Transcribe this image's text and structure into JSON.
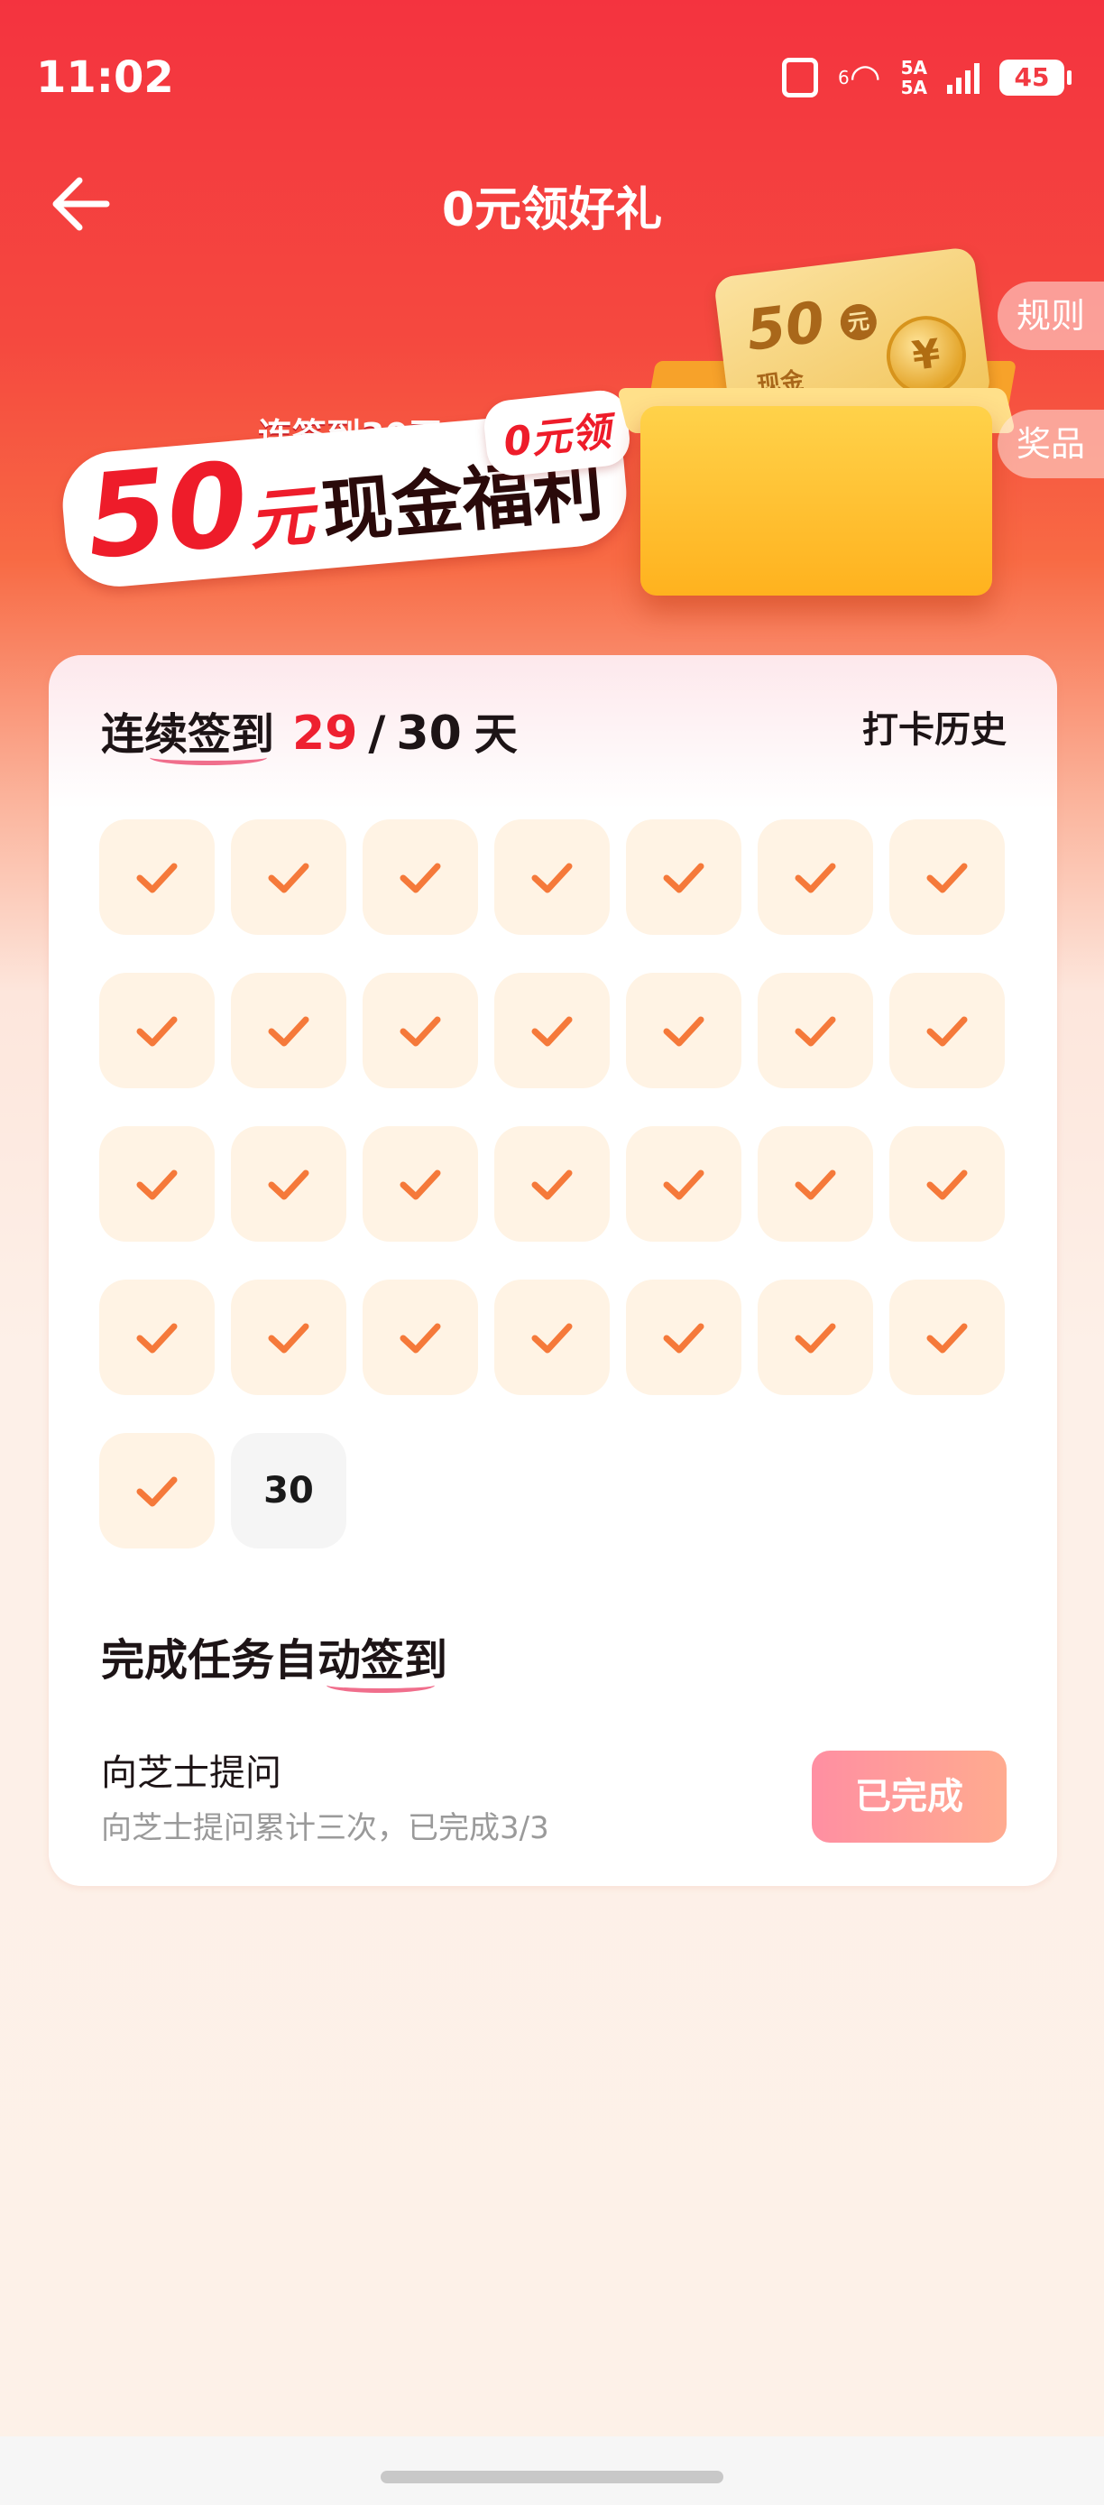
{
  "status_bar": {
    "time": "11:02",
    "network_label": "6",
    "signal_label_1": "5A",
    "signal_label_2": "5A",
    "battery": "45"
  },
  "header": {
    "title": "0元领好礼",
    "back_icon": "back-arrow-icon"
  },
  "hero": {
    "subtitle": "连签到30天",
    "amount": "50",
    "amount_unit": "元",
    "headline": "现金福利",
    "badge": "0元领",
    "card_amount": "50",
    "card_unit": "元",
    "card_label": "现金",
    "coin_symbol": "¥"
  },
  "side_tabs": {
    "rules": "规则",
    "prizes": "奖品"
  },
  "checkin": {
    "label": "连续签到",
    "current": "29",
    "separator": "/",
    "total": "30",
    "unit": "天",
    "history": "打卡历史",
    "pending_day": "30"
  },
  "tasks": {
    "section_title": "完成任务自动签到",
    "items": [
      {
        "name": "向芝士提问",
        "description": "向芝士提问累计三次，已完成3/3",
        "button": "已完成"
      }
    ]
  },
  "colors": {
    "brand_red": "#ee2030",
    "check_orange": "#f5793a",
    "done_button": "#ff9a9a"
  }
}
